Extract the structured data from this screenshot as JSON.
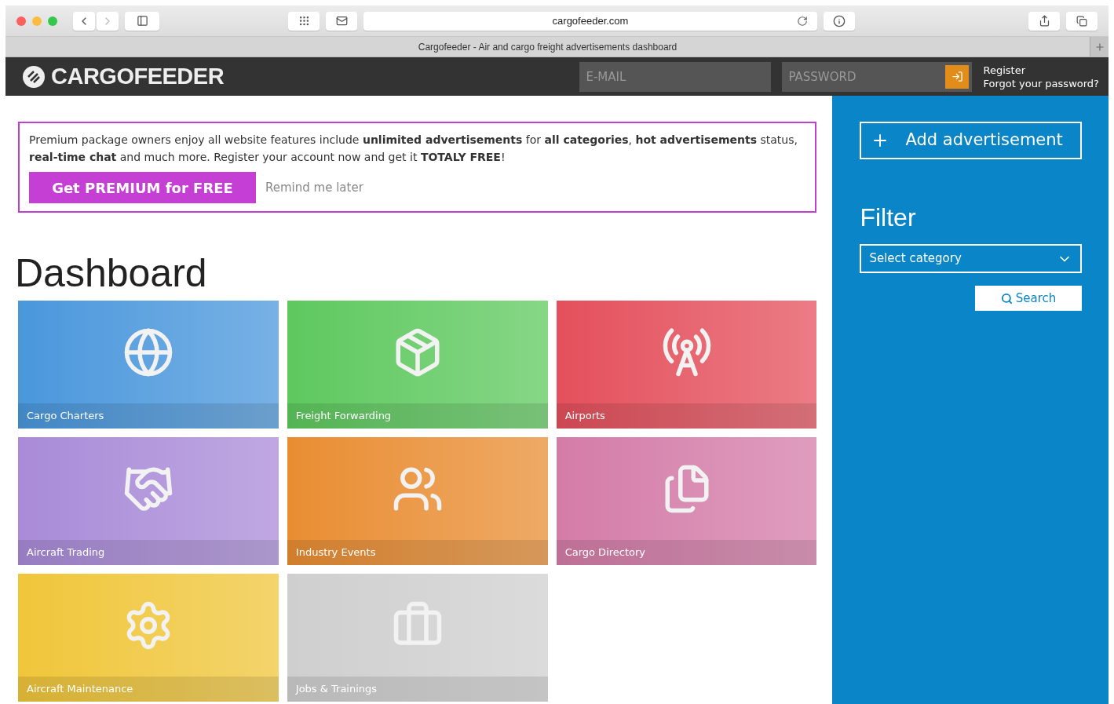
{
  "browser": {
    "url": "cargofeeder.com",
    "tab_title": "Cargofeeder - Air and cargo freight advertisements dashboard"
  },
  "header": {
    "logo": "CARGOFEEDER",
    "email": {
      "placeholder": "E-MAIL"
    },
    "password": {
      "placeholder": "PASSWORD"
    },
    "links": [
      "Register",
      "Forgot your password?"
    ]
  },
  "promo": {
    "text": "Premium package owners enjoy all website features include **unlimited advertisements** for **all categories**, **hot advertisements** status, **real-time chat** and much more. Register your account now and get it **TOTALY FREE**!",
    "primary_button": "Get PREMIUM for FREE",
    "secondary_link": "Remind me later"
  },
  "title": "Dashboard",
  "tiles": [
    {
      "label": "Cargo Charters",
      "kind": "globe",
      "color": "#4a97dc"
    },
    {
      "label": "Freight Forwarding",
      "kind": "box",
      "color": "#5ec95e"
    },
    {
      "label": "Airports",
      "kind": "tower",
      "color": "#e4505c"
    },
    {
      "label": "Aircraft Trading",
      "kind": "handshake",
      "color": "#a98bd8"
    },
    {
      "label": "Industry Events",
      "kind": "crowd",
      "color": "#e98d32"
    },
    {
      "label": "Cargo Directory",
      "kind": "documents",
      "color": "#d47ca8"
    },
    {
      "label": "Aircraft Maintenance",
      "kind": "engine",
      "color": "#f0c63a"
    },
    {
      "label": "Jobs & Trainings",
      "kind": "jobs",
      "color": "#cfcfcf"
    }
  ],
  "sidebar": {
    "add_button": "Add advertisement",
    "filter_title": "Filter",
    "category_select": "Select category",
    "search_button": "Search"
  }
}
